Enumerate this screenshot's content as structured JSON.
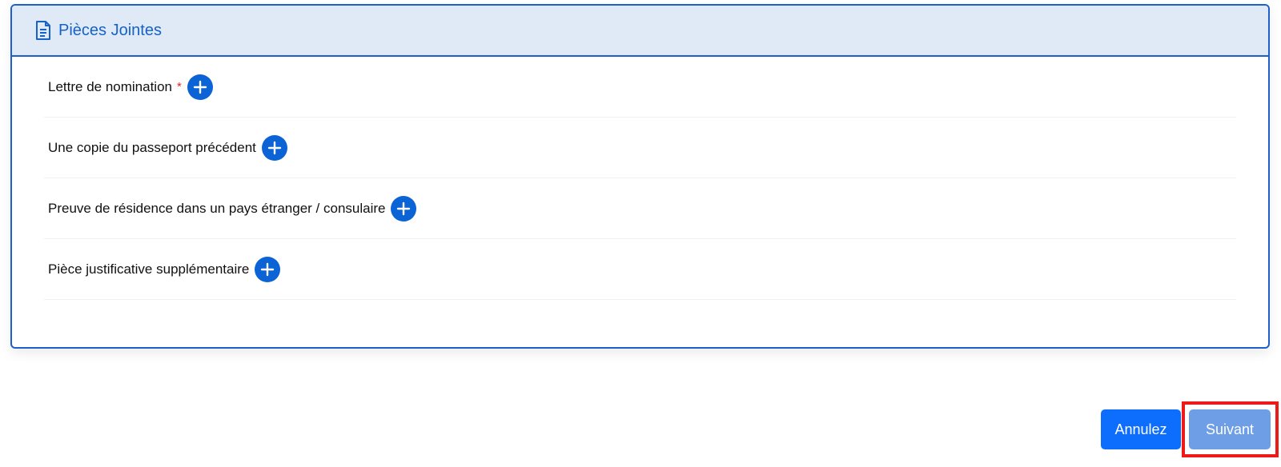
{
  "panel": {
    "title": "Pièces Jointes",
    "icon": "document-icon"
  },
  "attachments": [
    {
      "label": "Lettre de nomination",
      "required_mark": "*"
    },
    {
      "label": "Une copie du passeport précédent"
    },
    {
      "label": "Preuve de résidence dans un pays étranger / consulaire"
    },
    {
      "label": "Pièce justificative supplémentaire"
    }
  ],
  "actions": {
    "cancel_label": "Annulez",
    "next_label": "Suivant"
  },
  "colors": {
    "accent": "#0b63d6",
    "header_bg": "#dfeaf6",
    "border": "#1f5fc9",
    "next_disabled": "#6d9ee6",
    "highlight": "#ee1a1a"
  }
}
